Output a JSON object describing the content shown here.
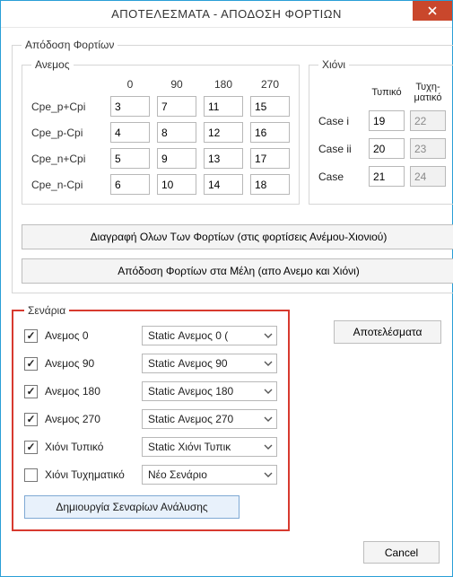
{
  "window": {
    "title": "ΑΠΟΤΕΛΕΣΜΑΤΑ - ΑΠΟΔΟΣΗ ΦΟΡΤΙΩΝ"
  },
  "apodosi": {
    "legend": "Απόδοση Φορτίων"
  },
  "anemos": {
    "legend": "Ανεμος",
    "cols": [
      "0",
      "90",
      "180",
      "270"
    ],
    "rows": [
      {
        "label": "Cpe_p+Cpi",
        "vals": [
          "3",
          "7",
          "11",
          "15"
        ]
      },
      {
        "label": "Cpe_p-Cpi",
        "vals": [
          "4",
          "8",
          "12",
          "16"
        ]
      },
      {
        "label": "Cpe_n+Cpi",
        "vals": [
          "5",
          "9",
          "13",
          "17"
        ]
      },
      {
        "label": "Cpe_n-Cpi",
        "vals": [
          "6",
          "10",
          "14",
          "18"
        ]
      }
    ]
  },
  "chioni": {
    "legend": "Χιόνι",
    "headers": [
      "Τυπικό",
      "Τυχη-\nματικό"
    ],
    "rows": [
      {
        "label": "Case i",
        "typ": "19",
        "acc": "22"
      },
      {
        "label": "Case ii",
        "typ": "20",
        "acc": "23"
      },
      {
        "label": "Case",
        "typ": "21",
        "acc": "24"
      }
    ]
  },
  "buttons": {
    "deleteAll": "Διαγραφή Ολων Των Φορτίων (στις φορτίσεις Ανέμου-Χιονιού)",
    "apply": "Απόδοση Φορτίων στα Μέλη (απο Ανεμο και Χιόνι)",
    "results": "Αποτελέσματα",
    "create": "Δημιουργία Σεναρίων Ανάλυσης",
    "cancel": "Cancel"
  },
  "scenaria": {
    "legend": "Σενάρια",
    "items": [
      {
        "checked": true,
        "label": "Ανεμος 0",
        "select": "Static Ανεμος 0 ("
      },
      {
        "checked": true,
        "label": "Ανεμος 90",
        "select": "Static Ανεμος 90"
      },
      {
        "checked": true,
        "label": "Ανεμος 180",
        "select": "Static Ανεμος 180"
      },
      {
        "checked": true,
        "label": "Ανεμος 270",
        "select": "Static Ανεμος 270"
      },
      {
        "checked": true,
        "label": "Χιόνι Τυπικό",
        "select": "Static Χιόνι Τυπικ"
      },
      {
        "checked": false,
        "label": "Χιόνι Τυχηματικό",
        "select": "Νέο Σενάριο"
      }
    ]
  }
}
